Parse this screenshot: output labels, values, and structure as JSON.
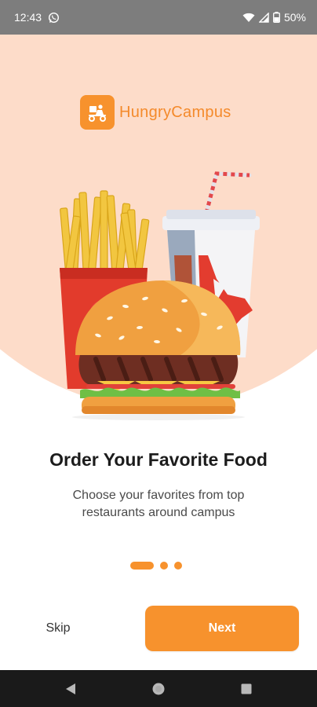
{
  "status_bar": {
    "time": "12:43",
    "battery": "50%",
    "icons": [
      "whatsapp-icon",
      "wifi-icon",
      "signal-icon",
      "battery-icon"
    ]
  },
  "brand": {
    "name": "HungryCampus",
    "accent_color": "#f7922d",
    "background_color": "#fddcc9"
  },
  "onboarding": {
    "title": "Order Your Favorite Food",
    "subtitle": "Choose your favorites from top restaurants around campus",
    "current_page": 1,
    "total_pages": 3,
    "illustration": "fries-drink-burger-illustration"
  },
  "actions": {
    "skip_label": "Skip",
    "next_label": "Next"
  },
  "nav_bar": {
    "icons": [
      "back-icon",
      "home-icon",
      "recents-icon"
    ]
  }
}
